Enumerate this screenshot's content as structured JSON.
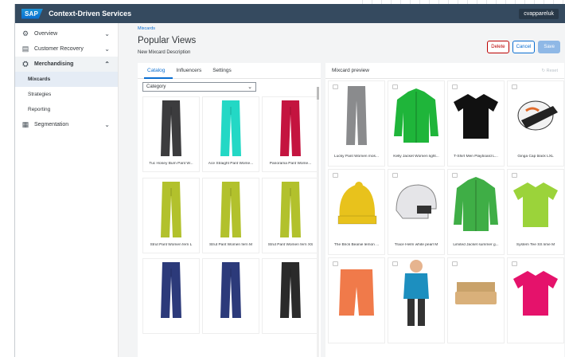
{
  "shell": {
    "brand": "SAP",
    "title": "Context-Driven Services",
    "user": "cvappareluk"
  },
  "sidebar": {
    "items": [
      {
        "label": "Overview",
        "icon": "dashboard-icon"
      },
      {
        "label": "Customer Recovery",
        "icon": "customer-icon"
      },
      {
        "label": "Merchandising",
        "icon": "merchandising-icon"
      },
      {
        "label": "Segmentation",
        "icon": "grid-icon"
      }
    ],
    "subitems": [
      "Mixcards",
      "Strategies",
      "Reporting"
    ]
  },
  "header": {
    "breadcrumb": "Mixcards",
    "title": "Popular Views",
    "description": "New Mixcard Description",
    "buttons": {
      "delete": "Delete",
      "cancel": "Cancel",
      "save": "Save"
    }
  },
  "left_panel": {
    "tabs": [
      "Catalog",
      "Influencers",
      "Settings"
    ],
    "select_value": "Category",
    "products": [
      {
        "name": "Tuc Honey Burn Pant W...",
        "color": "#3c3c3e"
      },
      {
        "name": "Ace Straight Pant Wome...",
        "color": "#23d8c5"
      },
      {
        "name": "Panorama Pant Wome...",
        "color": "#c4143f"
      },
      {
        "name": "Strut Pant Women fern L",
        "color": "#b2c12c"
      },
      {
        "name": "Strut Pant Women fern M",
        "color": "#b2c12c"
      },
      {
        "name": "Strut Pant Women fern XS",
        "color": "#b2c12c"
      },
      {
        "name": "",
        "color": "#2c3a7a"
      },
      {
        "name": "",
        "color": "#2c3a7a"
      },
      {
        "name": "",
        "color": "#2a2a2a"
      }
    ]
  },
  "preview": {
    "title": "Mixcard preview",
    "reset": "Reset",
    "items": [
      {
        "name": "Lucky Pant Women mos...",
        "kind": "pants",
        "color": "#8a8b8d"
      },
      {
        "name": "Kelly Jacket Women light...",
        "kind": "jacket",
        "color": "#1fb53a"
      },
      {
        "name": "T-Shirt Men Playboard L...",
        "kind": "tshirt",
        "color": "#111111"
      },
      {
        "name": "Ginga Cap black LXL",
        "kind": "cap",
        "color": "#f2f2f2"
      },
      {
        "name": "The Brick Beanie lemon ...",
        "kind": "beanie",
        "color": "#e8c21c"
      },
      {
        "name": "Trace Helm white pearl M",
        "kind": "helmet",
        "color": "#e5e5e8"
      },
      {
        "name": "Limited Jacket summer g...",
        "kind": "jacket",
        "color": "#3fae46"
      },
      {
        "name": "System Tee SS lime M",
        "kind": "tshirt",
        "color": "#9bd33a"
      },
      {
        "name": "",
        "kind": "shorts",
        "color": "#f07a4a"
      },
      {
        "name": "",
        "kind": "person",
        "color": "#1d8fbf"
      },
      {
        "name": "",
        "kind": "brush",
        "color": "#d9b07a"
      },
      {
        "name": "",
        "kind": "tshirt",
        "color": "#e5126b"
      }
    ]
  }
}
